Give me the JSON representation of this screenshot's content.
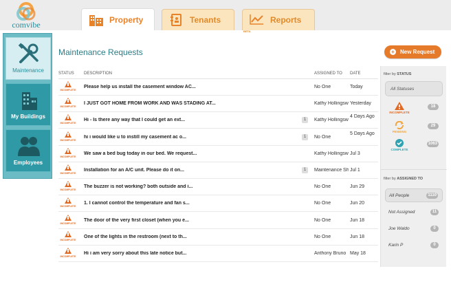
{
  "brand": {
    "name": "comvibe"
  },
  "tabs": [
    {
      "label": "Property",
      "icon": "building-icon",
      "active": true
    },
    {
      "label": "Tenants",
      "icon": "address-book-icon",
      "active": false
    },
    {
      "label": "Reports",
      "icon": "line-chart-icon",
      "active": false,
      "badge": "BETA"
    }
  ],
  "sidebar": {
    "items": [
      {
        "label": "Maintenance",
        "icon": "tools-icon",
        "active": true
      },
      {
        "label": "My Buildings",
        "icon": "buildings-icon",
        "active": false
      },
      {
        "label": "Employees",
        "icon": "people-icon",
        "active": false
      }
    ]
  },
  "main": {
    "title": "Maintenance Requests",
    "new_button": "New Request",
    "columns": {
      "status": "STATUS",
      "description": "DESCRIPTION",
      "assigned": "ASSIGNED TO",
      "date": "DATE"
    },
    "rows": [
      {
        "status": "INCOMPLETE",
        "description": "Please help us install the casement window AC...",
        "count": "",
        "assigned": "No One",
        "date": "Today"
      },
      {
        "status": "INCOMPLETE",
        "description": "I JUST GOT HOME FROM WORK AND WAS STADING AT...",
        "count": "",
        "assigned": "Kathy Hollingsw",
        "date": "Yesterday"
      },
      {
        "status": "INCOMPLETE",
        "description": "Hi - Is there any way that I could get an ext...",
        "count": "1",
        "assigned": "Kathy Hollingsw",
        "date": "4 Days Ago"
      },
      {
        "status": "INCOMPLETE",
        "description": "hi i would like u to instill my casement ac o...",
        "count": "1",
        "assigned": "No One",
        "date": "5 Days Ago"
      },
      {
        "status": "INCOMPLETE",
        "description": "We saw a bed bug today in our bed. We request...",
        "count": "",
        "assigned": "Kathy Hollingsw",
        "date": "Jul 3"
      },
      {
        "status": "INCOMPLETE",
        "description": "Installation for an A/C unit. Please do it on...",
        "count": "1",
        "assigned": "Maintenance Sho",
        "date": "Jul 1"
      },
      {
        "status": "INCOMPLETE",
        "description": "The buzzer is not working? both outside and i...",
        "count": "",
        "assigned": "No One",
        "date": "Jun 29"
      },
      {
        "status": "INCOMPLETE",
        "description": "1. I cannot control the temperature and fan s...",
        "count": "",
        "assigned": "No One",
        "date": "Jun 20"
      },
      {
        "status": "INCOMPLETE",
        "description": "The door of the very first closet (when you e...",
        "count": "",
        "assigned": "No One",
        "date": "Jun 18"
      },
      {
        "status": "INCOMPLETE",
        "description": "One of the lights in the restroom (next to th...",
        "count": "",
        "assigned": "No One",
        "date": "Jun 18"
      },
      {
        "status": "INCOMPLETE",
        "description": "Hi i am very sorry about this late notice but...",
        "count": "",
        "assigned": "Anthony Bruno",
        "date": "May 18"
      }
    ]
  },
  "filters": {
    "status_head_prefix": "filter by",
    "status_head_key": "STATUS",
    "all_statuses": "All Statuses",
    "status_items": [
      {
        "label": "INCOMPLETE",
        "count": "18",
        "color": "#e06a24",
        "icon": "warning-icon"
      },
      {
        "label": "PENDING",
        "count": "29",
        "color": "#f2a640",
        "icon": "refresh-icon"
      },
      {
        "label": "COMPLETE",
        "count": "1063",
        "color": "#2fa3b1",
        "icon": "check-icon"
      }
    ],
    "assigned_head_prefix": "filter by",
    "assigned_head_key": "ASSIGNED TO",
    "assigned_items": [
      {
        "label": "All People",
        "count": "1110",
        "selected": true
      },
      {
        "label": "Not Assigned",
        "count": "11",
        "selected": false
      },
      {
        "label": "Joe Waldo",
        "count": "0",
        "selected": false
      },
      {
        "label": "Karin P",
        "count": "0",
        "selected": false
      }
    ]
  }
}
